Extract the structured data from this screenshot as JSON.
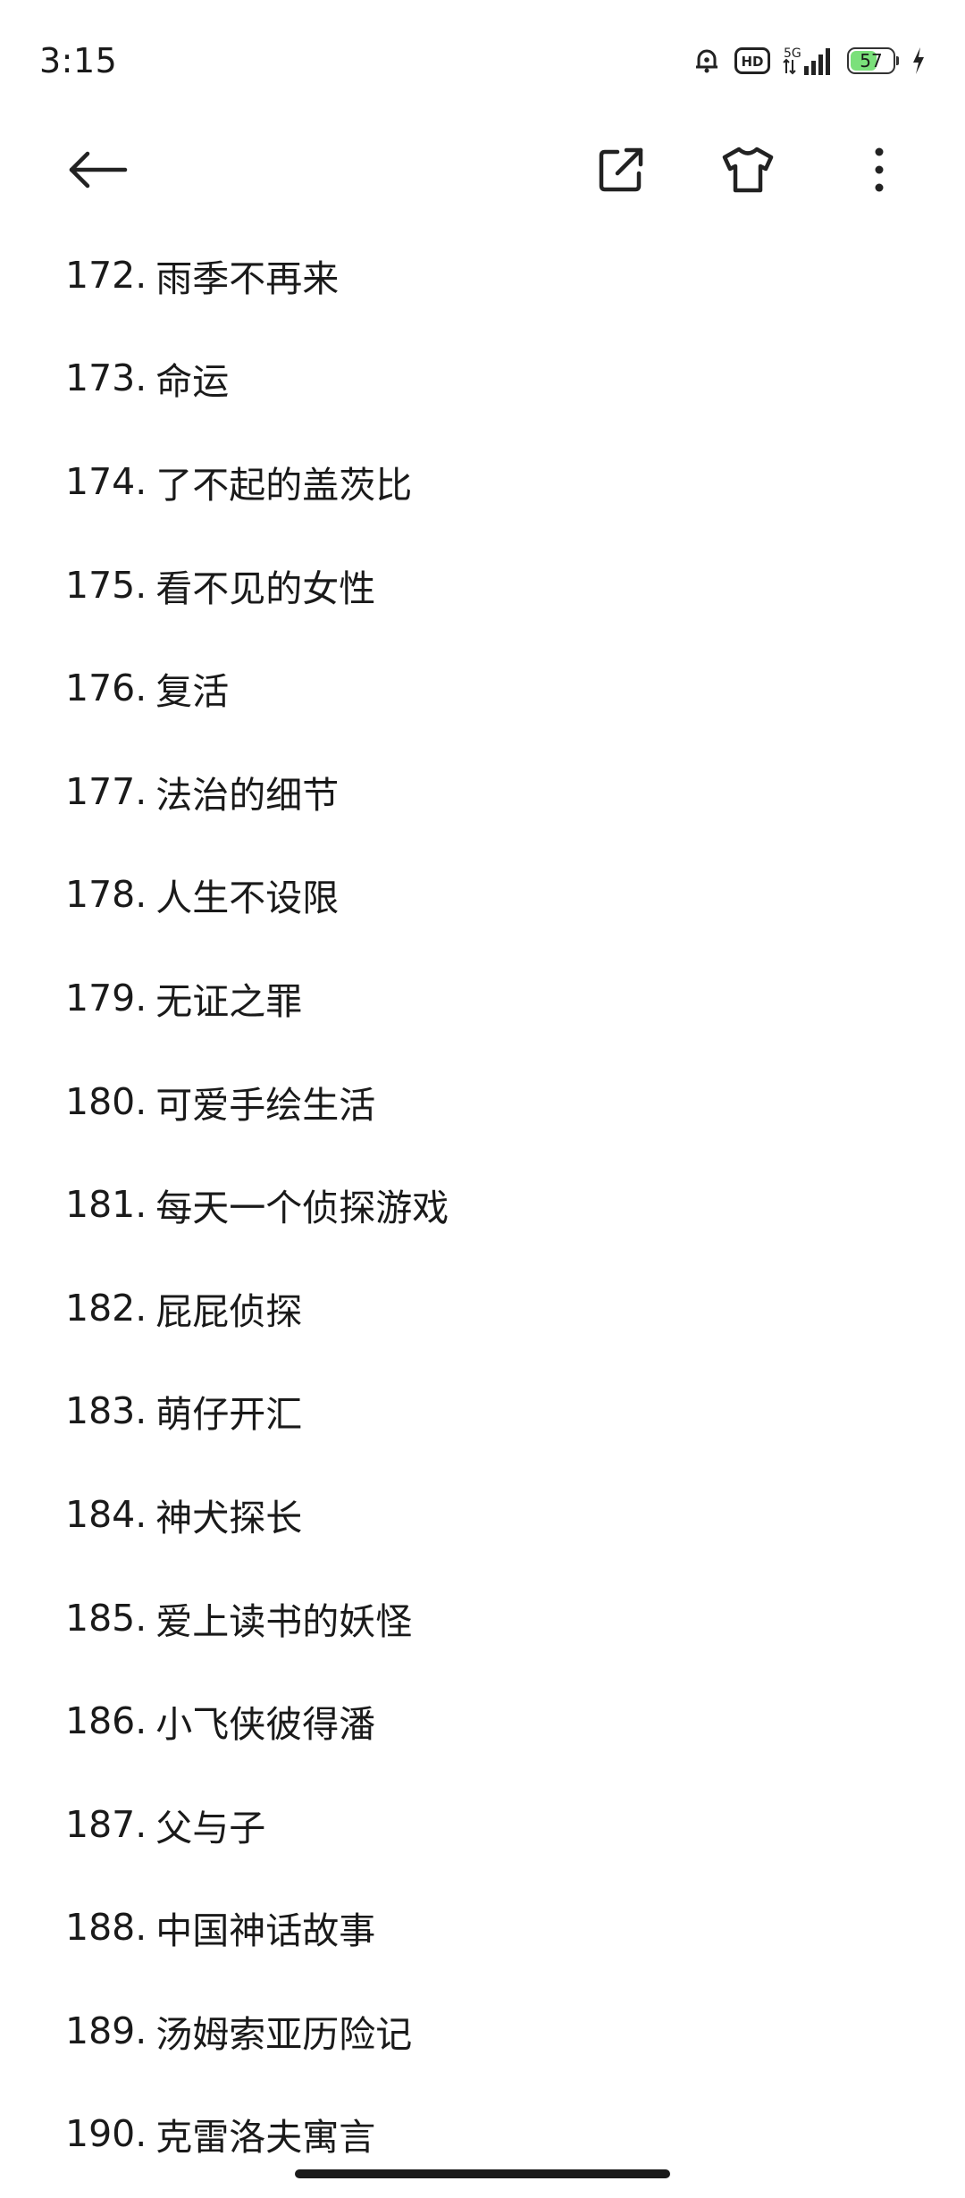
{
  "status_bar": {
    "time": "3:15",
    "network": "5G",
    "hd_label": "HD",
    "battery": {
      "level": 57,
      "text": "57",
      "color": "#7be07b",
      "charging": true
    },
    "icons": [
      "alarm-icon",
      "hd-icon",
      "signal-5g-icon",
      "battery-icon",
      "charging-bolt-icon"
    ]
  },
  "toolbar": {
    "icons": [
      "back-arrow-icon",
      "share-icon",
      "theme-shirt-icon",
      "more-vertical-icon"
    ]
  },
  "list": {
    "items": [
      {
        "num": "172.",
        "title": "雨季不再来"
      },
      {
        "num": "173.",
        "title": "命运"
      },
      {
        "num": "174.",
        "title": "了不起的盖茨比"
      },
      {
        "num": "175.",
        "title": "看不见的女性"
      },
      {
        "num": "176.",
        "title": "复活"
      },
      {
        "num": "177.",
        "title": "法治的细节"
      },
      {
        "num": "178.",
        "title": "人生不设限"
      },
      {
        "num": "179.",
        "title": "无证之罪"
      },
      {
        "num": "180.",
        "title": "可爱手绘生活"
      },
      {
        "num": "181.",
        "title": "每天一个侦探游戏"
      },
      {
        "num": "182.",
        "title": "屁屁侦探"
      },
      {
        "num": "183.",
        "title": "萌仔开汇"
      },
      {
        "num": "184.",
        "title": "神犬探长"
      },
      {
        "num": "185.",
        "title": "爱上读书的妖怪"
      },
      {
        "num": "186.",
        "title": "小飞侠彼得潘"
      },
      {
        "num": "187.",
        "title": "父与子"
      },
      {
        "num": "188.",
        "title": "中国神话故事"
      },
      {
        "num": "189.",
        "title": "汤姆索亚历险记"
      },
      {
        "num": "190.",
        "title": "克雷洛夫寓言"
      }
    ]
  }
}
